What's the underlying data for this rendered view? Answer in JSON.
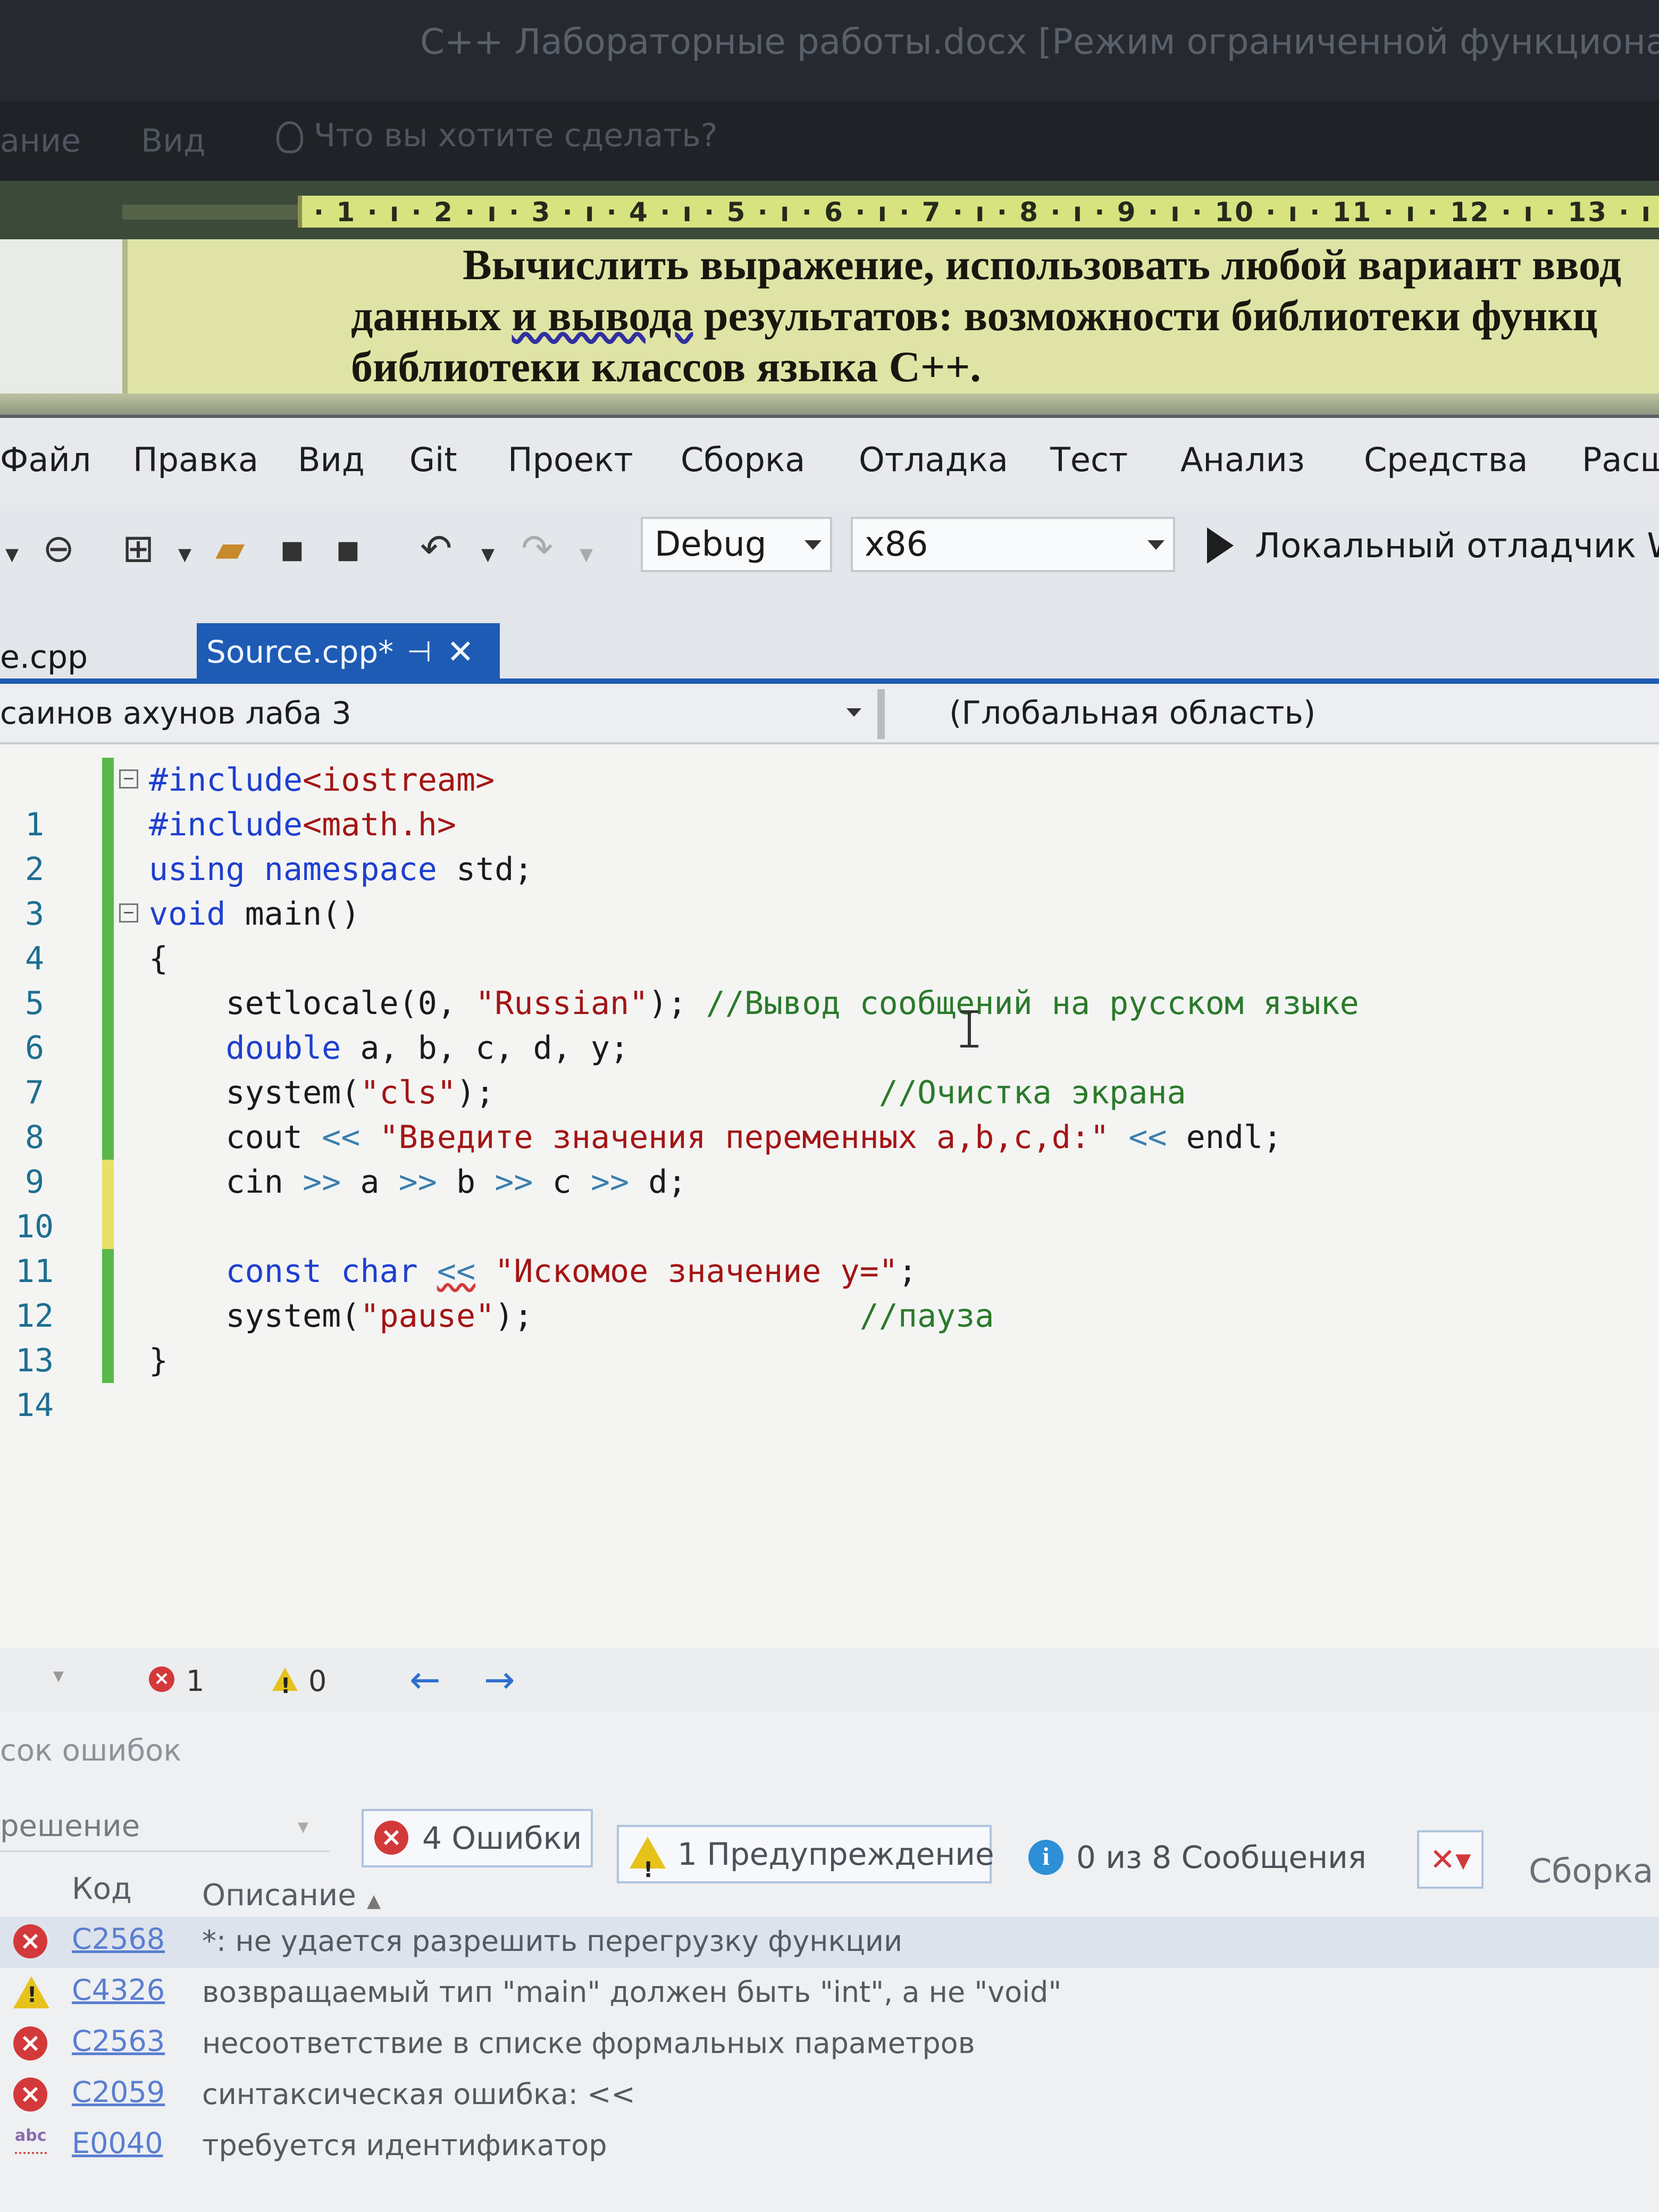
{
  "word": {
    "title": "C++ Лабораторные работы.docx [Режим ограниченной функциональности]",
    "ribbon_tabs": [
      "ание",
      "Вид"
    ],
    "tell_me": "Что вы хотите сделать?",
    "ruler": "· 1 · ı · 2 · ı · 3 · ı · 4 · ı · 5 · ı · 6 · ı · 7 · ı · 8 · ı · 9 · ı · 10 · ı · 11 · ı · 12 · ı · 13 · ı · 1",
    "line1": "Вычислить выражение, использовать любой вариант ввод",
    "line2_a": "данных ",
    "line2_b": "и вывода",
    "line2_c": " результатов: возможности библиотеки функц",
    "line3": "библиотеки классов языка С++."
  },
  "vs": {
    "menu": [
      "Файл",
      "Правка",
      "Вид",
      "Git",
      "Проект",
      "Сборка",
      "Отладка",
      "Тест",
      "Анализ",
      "Средства",
      "Расш"
    ],
    "config": "Debug",
    "platform": "x86",
    "debugger": "Локальный отладчик W",
    "tabs": {
      "inactive": "e.cpp",
      "active": "Source.cpp*",
      "pin": "⊣",
      "close": "✕"
    },
    "nav_project": "саинов ахунов лаба 3",
    "nav_scope": "(Глобальная область)"
  },
  "code": [
    {
      "n": "1",
      "t": "#include<iostream>"
    },
    {
      "n": "2",
      "t": "#include<math.h>"
    },
    {
      "n": "3",
      "t": "using namespace std;"
    },
    {
      "n": "4",
      "t": "void main()"
    },
    {
      "n": "5",
      "t": "{"
    },
    {
      "n": "6",
      "t": "setlocale(0, \"Russian\"); //Вывод сообщений на русском языке"
    },
    {
      "n": "7",
      "t": "double a, b, c, d, y;"
    },
    {
      "n": "8",
      "t": "system(\"cls\");                    //Очистка экрана"
    },
    {
      "n": "9",
      "t": "cout << \"Введите значения переменных a,b,c,d:\" << endl;"
    },
    {
      "n": "10",
      "t": "cin >> a >> b >> c >> d;"
    },
    {
      "n": "11",
      "t": ""
    },
    {
      "n": "12",
      "t": "const char << \"Искомое значение y=\";"
    },
    {
      "n": "13",
      "t": "system(\"pause\");                 //пауза"
    },
    {
      "n": "14",
      "t": "}"
    }
  ],
  "status": {
    "errors": "1",
    "warnings": "0"
  },
  "error_list": {
    "title": "сок ошибок",
    "scope": "решение",
    "errors_btn": "4 Ошибки",
    "warnings_btn": "1 Предупреждение",
    "messages_btn": "0 из 8 Сообщения",
    "build_label": "Сборка",
    "col_code": "Код",
    "col_desc": "Описание",
    "rows": [
      {
        "kind": "error",
        "code": "C2568",
        "desc": "*: не удается разрешить перегрузку функции"
      },
      {
        "kind": "warning",
        "code": "C4326",
        "desc": "возвращаемый тип \"main\" должен быть \"int\", а не \"void\""
      },
      {
        "kind": "error",
        "code": "C2563",
        "desc": "несоответствие в списке формальных параметров"
      },
      {
        "kind": "error",
        "code": "C2059",
        "desc": "синтаксическая ошибка: <<"
      },
      {
        "kind": "intellisense",
        "code": "E0040",
        "desc": "требуется идентификатор"
      }
    ]
  }
}
